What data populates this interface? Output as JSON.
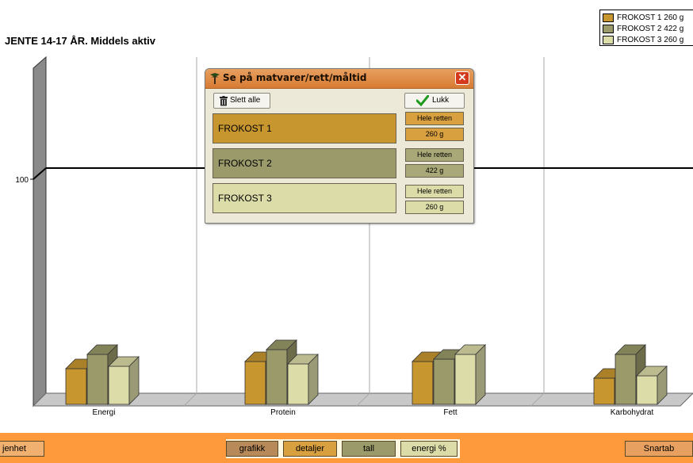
{
  "page": {
    "title": "JENTE 14-17 ÅR. Middels aktiv"
  },
  "legend": [
    {
      "label": "FROKOST 1 260 g",
      "color": "#c8962f"
    },
    {
      "label": "FROKOST 2 422 g",
      "color": "#9a9a6a"
    },
    {
      "label": "FROKOST 3 260 g",
      "color": "#dcdca8"
    }
  ],
  "chart_data": {
    "type": "bar",
    "title": "JENTE 14-17 ÅR. Middels aktiv",
    "categories": [
      "Energi",
      "Protein",
      "Fett",
      "Karbohydrat"
    ],
    "series": [
      {
        "name": "FROKOST 1 260 g",
        "color": "#c8962f",
        "values": [
          15,
          18,
          18,
          11
        ]
      },
      {
        "name": "FROKOST 2 422 g",
        "color": "#9a9a6a",
        "values": [
          21,
          23,
          19,
          21
        ]
      },
      {
        "name": "FROKOST 3 260 g",
        "color": "#dcdca8",
        "values": [
          16,
          17,
          21,
          12
        ]
      }
    ],
    "y_tick_labels": [
      {
        "value": 100,
        "label": "100"
      }
    ],
    "ylim": [
      0,
      100
    ],
    "reference_line": 100,
    "grid": true,
    "legend_position": "top-right"
  },
  "dialog": {
    "title": "Se på matvarer/rett/måltid",
    "delete_all_label": "Slett alle",
    "close_label": "Lukk",
    "close_x": "✕",
    "meals": [
      {
        "name": "FROKOST 1",
        "portion_label": "Hele retten",
        "amount": "260 g",
        "color": "#c8962f",
        "btn_color": "#d9a040"
      },
      {
        "name": "FROKOST 2",
        "portion_label": "Hele retten",
        "amount": "422 g",
        "color": "#9a9a6a",
        "btn_color": "#a8a878"
      },
      {
        "name": "FROKOST 3",
        "portion_label": "Hele retten",
        "amount": "260 g",
        "color": "#dcdca8",
        "btn_color": "#dcdca8"
      }
    ]
  },
  "toolbar": {
    "left_label": "jenhet",
    "right_label": "Snartab",
    "tabs": [
      {
        "label": "grafikk",
        "color": "#b88a5a"
      },
      {
        "label": "detaljer",
        "color": "#d9a040"
      },
      {
        "label": "tall",
        "color": "#9a9a6a"
      },
      {
        "label": "energi %",
        "color": "#dcdca8"
      }
    ]
  }
}
